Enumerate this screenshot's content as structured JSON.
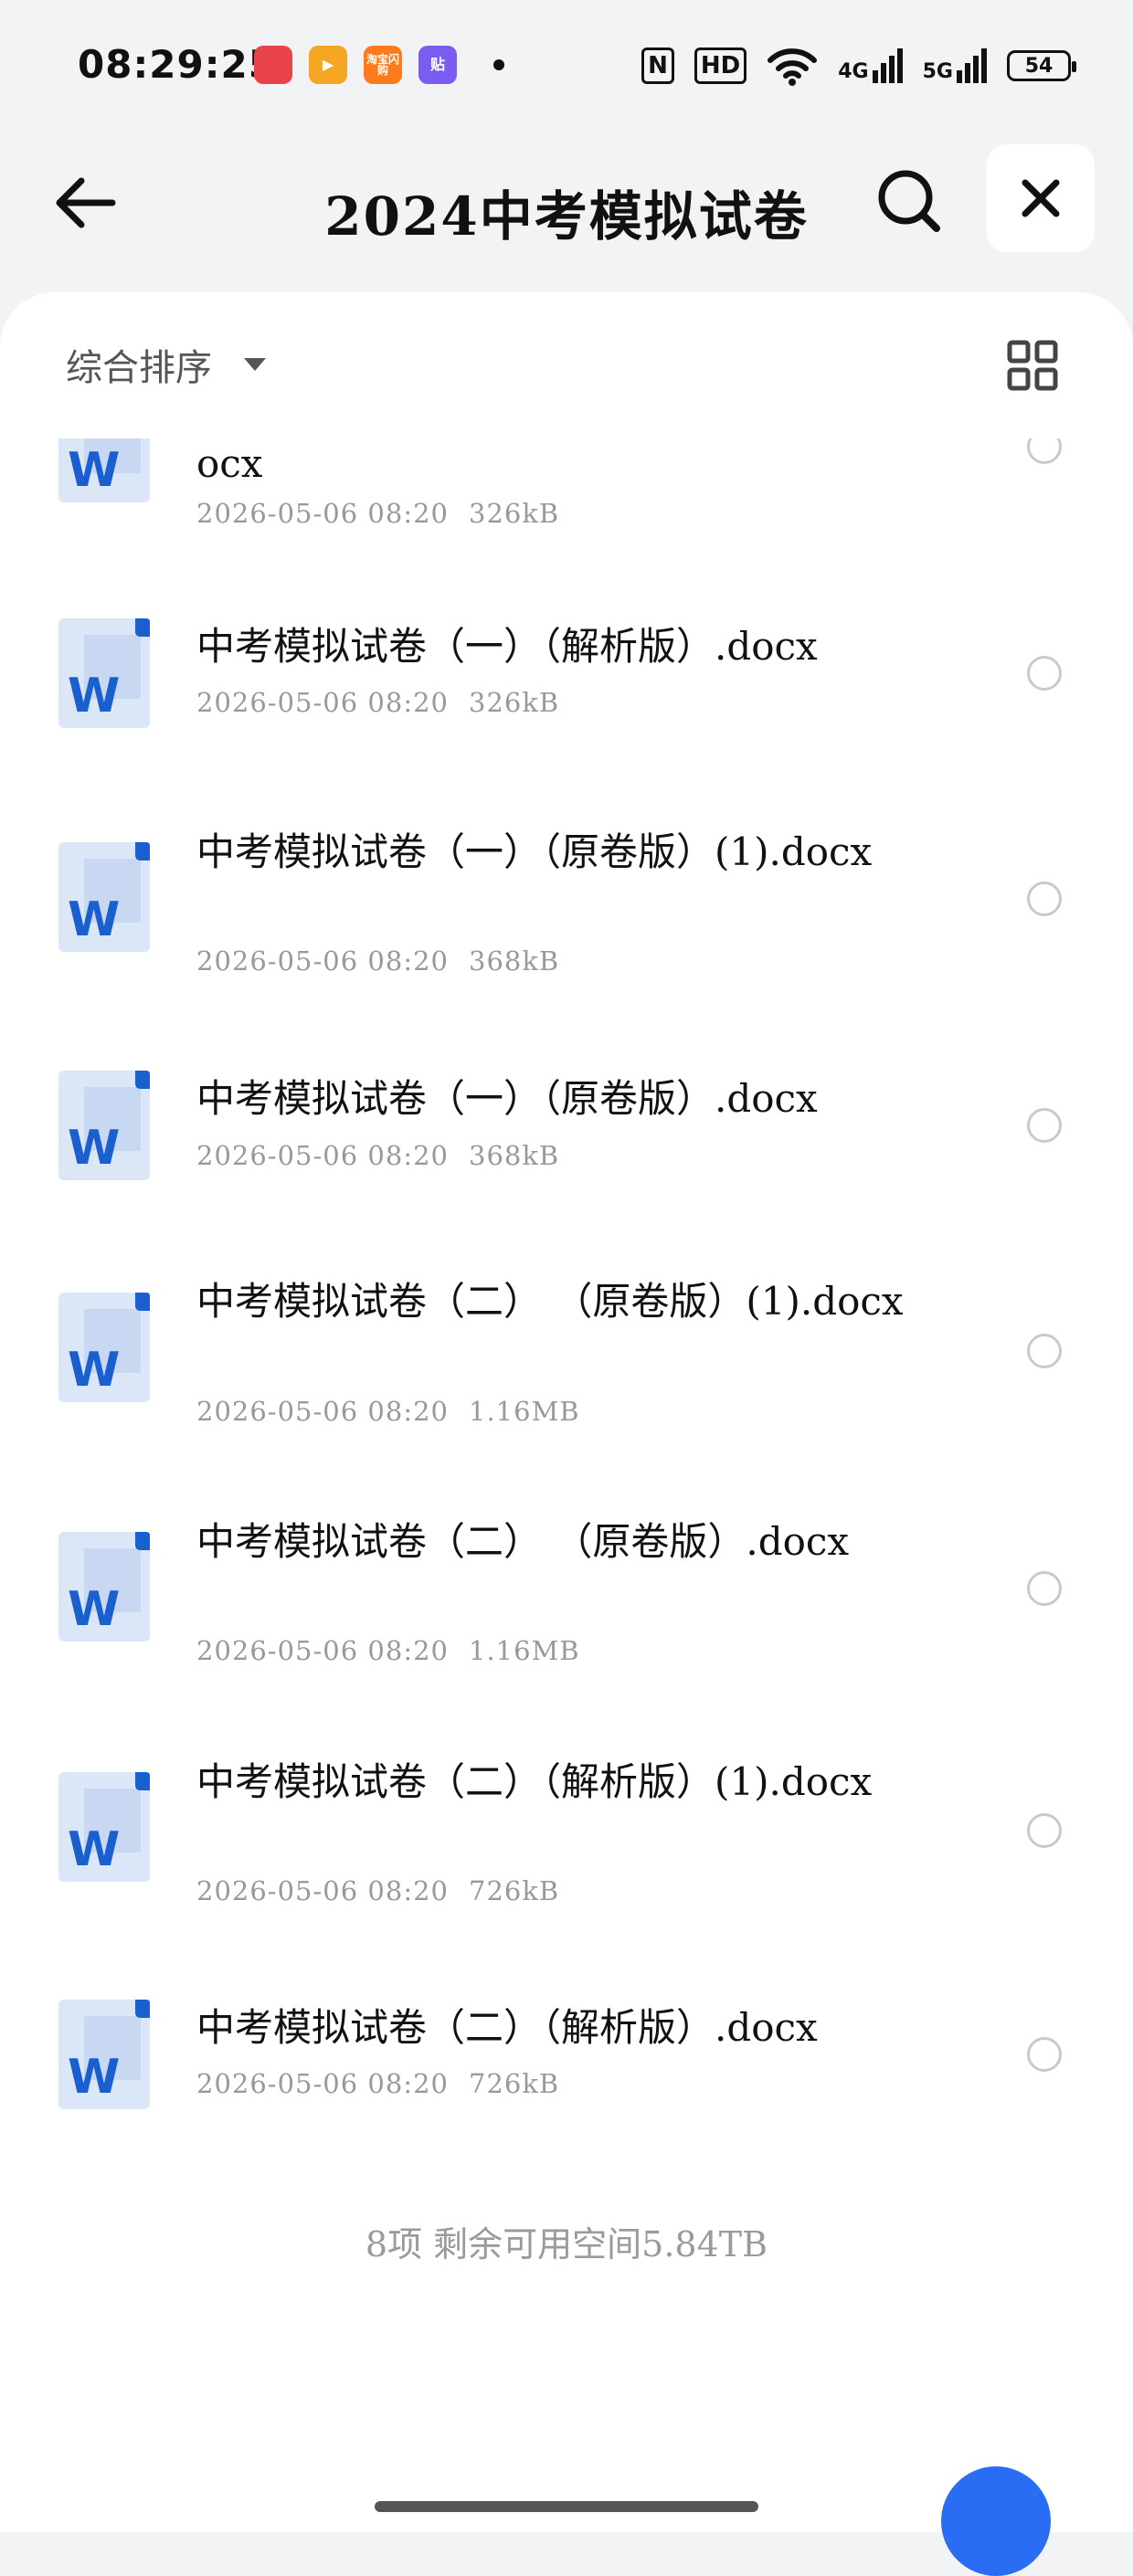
{
  "status_bar": {
    "time": "08:29:25",
    "apps": [
      {
        "icon": "red-app-icon",
        "label": "",
        "color": "#e8424a"
      },
      {
        "icon": "tv-app-icon",
        "label": "▶",
        "color": "#f5a623"
      },
      {
        "icon": "taobao-flash-icon",
        "label": "淘宝闪购",
        "color": "#ff7a1a"
      },
      {
        "icon": "sticker-app-icon",
        "label": "贴",
        "color": "#7b5cf0"
      }
    ],
    "nfc": "N",
    "hd": "HD",
    "net1": "4G",
    "net2": "5G",
    "battery": "54"
  },
  "header": {
    "title": "2024中考模拟试卷"
  },
  "sort": {
    "label": "综合排序"
  },
  "files": [
    {
      "name": "ocx",
      "date": "2026-05-06 08:20",
      "size": "326kB"
    },
    {
      "name": "中考模拟试卷（一）（解析版）.docx",
      "date": "2026-05-06 08:20",
      "size": "326kB"
    },
    {
      "name": "中考模拟试卷（一）（原卷版）(1).docx",
      "date": "2026-05-06 08:20",
      "size": "368kB"
    },
    {
      "name": "中考模拟试卷（一）（原卷版）.docx",
      "date": "2026-05-06 08:20",
      "size": "368kB"
    },
    {
      "name": "中考模拟试卷（二） （原卷版）(1).docx",
      "date": "2026-05-06 08:20",
      "size": "1.16MB"
    },
    {
      "name": "中考模拟试卷（二） （原卷版）.docx",
      "date": "2026-05-06 08:20",
      "size": "1.16MB"
    },
    {
      "name": "中考模拟试卷（二）（解析版）(1).docx",
      "date": "2026-05-06 08:20",
      "size": "726kB"
    },
    {
      "name": "中考模拟试卷（二）（解析版）.docx",
      "date": "2026-05-06 08:20",
      "size": "726kB"
    }
  ],
  "summary": "8项 剩余可用空间5.84TB",
  "colors": {
    "word_blue": "#1a5fd0",
    "word_light": "#dbe6f7",
    "fab": "#2a6df5"
  }
}
